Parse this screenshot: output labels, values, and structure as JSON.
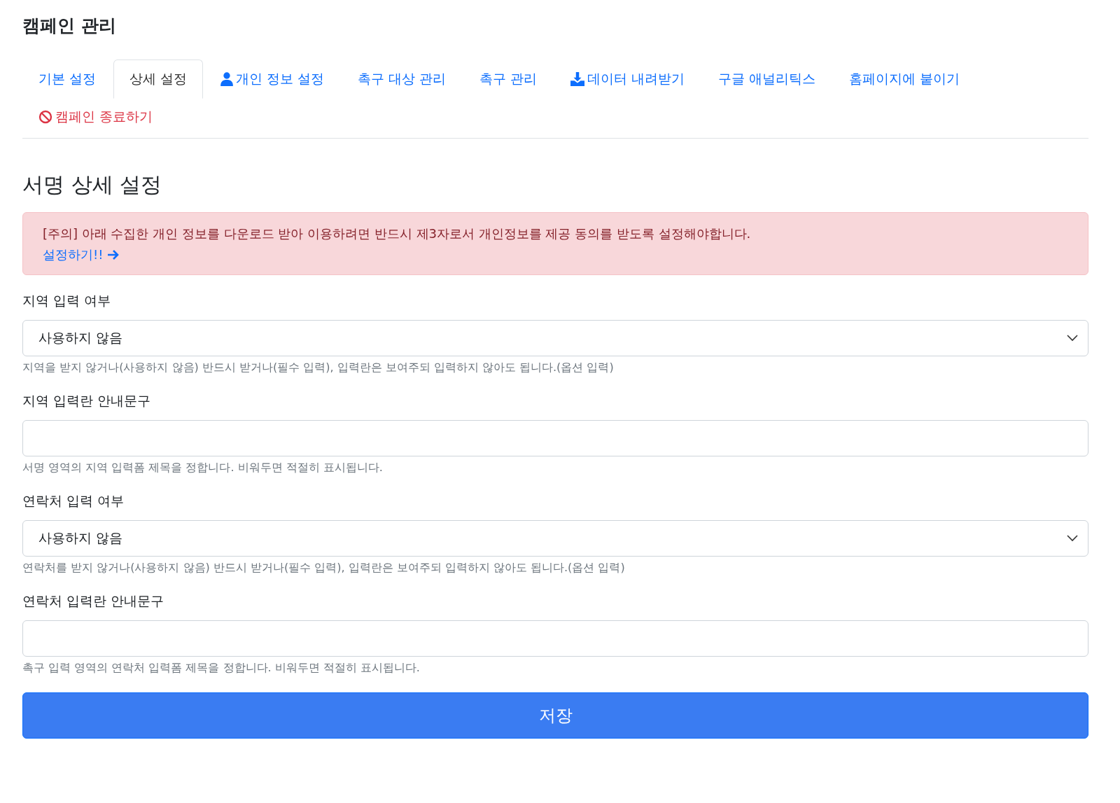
{
  "page_title": "캠페인 관리",
  "tabs": [
    {
      "label": "기본 설정",
      "kind": "plain",
      "selected": false
    },
    {
      "label": "상세 설정",
      "kind": "plain",
      "selected": true
    },
    {
      "label": "개인 정보 설정",
      "kind": "person",
      "selected": false
    },
    {
      "label": "촉구 대상 관리",
      "kind": "plain",
      "selected": false
    },
    {
      "label": "촉구 관리",
      "kind": "plain",
      "selected": false
    },
    {
      "label": "데이터 내려받기",
      "kind": "download",
      "selected": false
    },
    {
      "label": "구글 애널리틱스",
      "kind": "plain",
      "selected": false
    },
    {
      "label": "홈페이지에 붙이기",
      "kind": "plain",
      "selected": false
    },
    {
      "label": "캠페인 종료하기",
      "kind": "danger",
      "selected": false
    }
  ],
  "section_title": "서명 상세 설정",
  "alert": {
    "message": "[주의] 아래 수집한 개인 정보를 다운로드 받아 이용하려면 반드시 제3자로서 개인정보를 제공 동의를 받도록 설정해야합니다.",
    "link": "설정하기!!"
  },
  "fields": [
    {
      "kind": "select",
      "label": "지역 입력 여부",
      "value": "사용하지 않음",
      "help": "지역을 받지 않거나(사용하지 않음) 반드시 받거나(필수 입력), 입력란은 보여주되 입력하지 않아도 됩니다.(옵션 입력)"
    },
    {
      "kind": "text",
      "label": "지역 입력란 안내문구",
      "help": "서명 영역의 지역 입력폼 제목을 정합니다. 비워두면 적절히 표시됩니다."
    },
    {
      "kind": "select",
      "label": "연락처 입력 여부",
      "value": "사용하지 않음",
      "help": "연락처를 받지 않거나(사용하지 않음) 반드시 받거나(필수 입력), 입력란은 보여주되 입력하지 않아도 됩니다.(옵션 입력)"
    },
    {
      "kind": "text",
      "label": "연락처 입력란 안내문구",
      "help": "촉구 입력 영역의 연락처 입력폼 제목을 정합니다. 비워두면 적절히 표시됩니다."
    }
  ],
  "save_button": "저장"
}
